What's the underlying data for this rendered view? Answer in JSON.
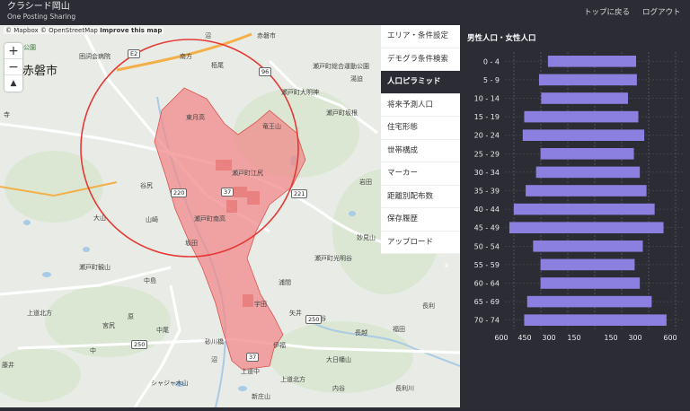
{
  "header": {
    "title": "クラシード岡山",
    "subtitle": "One Posting Sharing",
    "links": [
      "トップに戻る",
      "ログアウト"
    ]
  },
  "map": {
    "attribution": [
      "© Mapbox",
      "© OpenStreetMap",
      "Improve this map"
    ],
    "zoom_in": "+",
    "zoom_out": "−",
    "compass": "▲",
    "labels": [
      "公園",
      "赤磐市",
      "困詞会病院",
      "南方",
      "沼",
      "栢尾",
      "赤磐市",
      "瀬戸町総合運動公園",
      "湯迫",
      "瀬戸町大明神",
      "東月高",
      "竜王山",
      "瀬戸町江尻",
      "瀬戸町坂根",
      "岩田",
      "谷尻",
      "瀬戸町南高",
      "大山",
      "山崎",
      "寺",
      "坂田",
      "妙見山",
      "瀬戸町観山",
      "瀬戸町光明谷",
      "中島",
      "原",
      "宇田",
      "中尾",
      "上道北方",
      "砂川橋",
      "中",
      "沼",
      "長越",
      "上道中",
      "浦間",
      "矢井",
      "上道北方",
      "谷",
      "伊福",
      "内谷",
      "大日幡山",
      "新庄山",
      "シャジャ木山",
      "藤井",
      "宮尻",
      "福田",
      "長利",
      "長利川"
    ],
    "shields": [
      "E2",
      "96",
      "220",
      "37",
      "221",
      "250",
      "250",
      "37"
    ],
    "circle_color": "#e53935",
    "area_fill": "#f08a8a"
  },
  "menu": {
    "items": [
      "エリア・条件設定",
      "デモグラ条件検索",
      "人口ピラミッド",
      "将来予測人口",
      "住宅形態",
      "世帯構成",
      "マーカー",
      "距離別配布数",
      "保存履歴",
      "アップロード"
    ],
    "active_index": 2,
    "collapse": "›"
  },
  "chart_data": {
    "type": "bar",
    "title": "男性人口・女性人口",
    "categories": [
      "0 - 4",
      "5 - 9",
      "10 - 14",
      "15 - 19",
      "20 - 24",
      "25 - 29",
      "30 - 34",
      "35 - 39",
      "40 - 44",
      "45 - 49",
      "50 - 54",
      "55 - 59",
      "60 - 64",
      "65 - 69",
      "70 - 74"
    ],
    "series": [
      {
        "values": [
          310,
          370,
          355,
          470,
          480,
          360,
          390,
          460,
          540,
          570,
          410,
          360,
          360,
          450,
          470
        ]
      },
      {
        "values": [
          285,
          290,
          230,
          300,
          340,
          270,
          310,
          355,
          410,
          470,
          330,
          275,
          310,
          390,
          490
        ]
      }
    ],
    "xticks": [
      "600",
      "450",
      "300",
      "150",
      "150",
      "300",
      "600"
    ],
    "bar_color": "#8b80e0",
    "grid": true
  }
}
